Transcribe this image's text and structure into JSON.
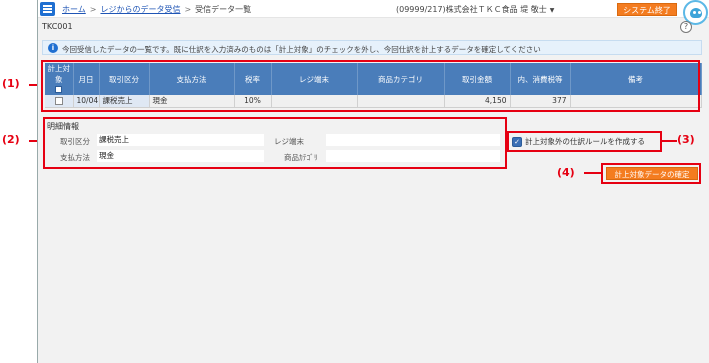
{
  "header": {
    "breadcrumb": [
      {
        "label": "ホーム",
        "link": true
      },
      {
        "label": "レジからのデータ受信",
        "link": true
      },
      {
        "label": "受信データ一覧",
        "link": false
      }
    ],
    "separator": ">",
    "company": "(09999/217)株式会社ＴＫＣ食品 堤 敬士",
    "exit_label": "システム終了"
  },
  "screen_id": "TKC001",
  "help_label": "?",
  "info_message": "今回受信したデータの一覧です。既に仕訳を入力済みのものは「計上対象」のチェックを外し、今回仕訳を計上するデータを確定してください",
  "table": {
    "headers": [
      "計上対象",
      "月日",
      "取引区分",
      "支払方法",
      "税率",
      "レジ端末",
      "商品カテゴリ",
      "取引金額",
      "内、消費税等",
      "備考"
    ],
    "rows": [
      {
        "date": "10/04",
        "kubun": "課税売上",
        "method": "現金",
        "tax": "10%",
        "register": "",
        "category": "",
        "amount": "4,150",
        "consumption_tax": "377",
        "note": ""
      }
    ]
  },
  "detail": {
    "title": "明細情報",
    "kubun_label": "取引区分",
    "kubun_value": "課税売上",
    "method_label": "支払方法",
    "method_value": "現金",
    "register_label": "レジ端末",
    "register_value": "",
    "category_label": "商品ｶﾃｺﾞﾘ",
    "category_value": ""
  },
  "rule_checkbox_label": "計上対象外の仕訳ルールを作成する",
  "confirm_button": "計上対象データの確定",
  "callouts": [
    "(1)",
    "(2)",
    "(3)",
    "(4)"
  ],
  "colors": {
    "accent": "#1f6fd1",
    "header_table": "#4a7dba",
    "button": "#f47c20",
    "callout": "#e60012"
  }
}
